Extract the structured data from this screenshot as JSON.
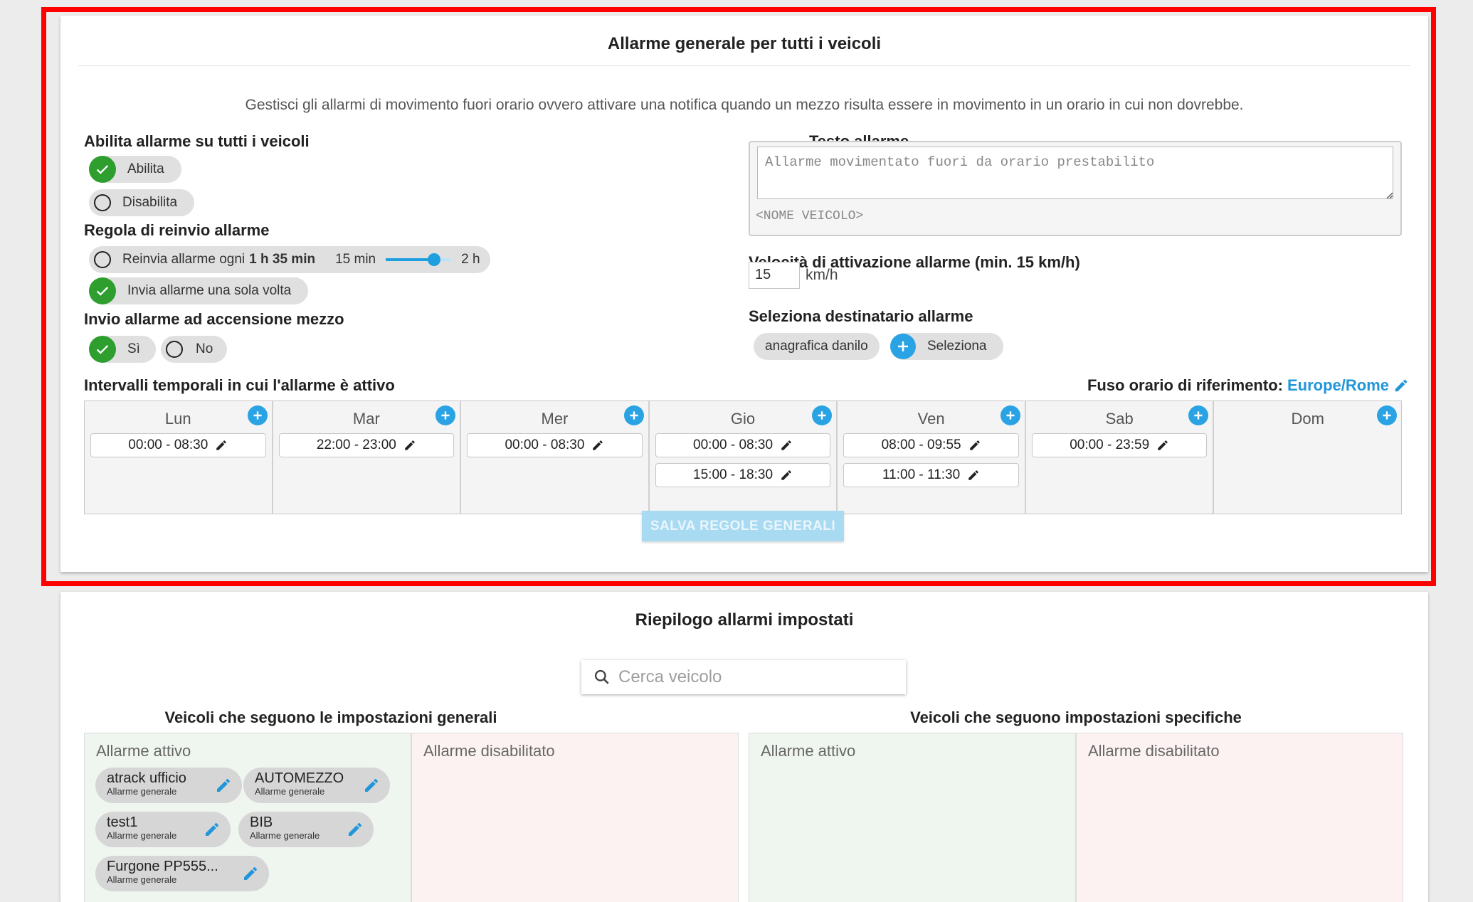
{
  "general": {
    "title": "Allarme generale per tutti i veicoli",
    "description": "Gestisci gli allarmi di movimento fuori orario ovvero attivare una notifica quando un mezzo risulta essere in movimento in un orario in cui non dovrebbe.",
    "enable_section": {
      "label": "Abilita allarme su tutti i veicoli",
      "options": [
        {
          "label": "Abilita",
          "selected": true
        },
        {
          "label": "Disabilita",
          "selected": false
        }
      ]
    },
    "resend_section": {
      "label": "Regola di reinvio allarme",
      "repeat_prefix": "Reinvia allarme ogni",
      "repeat_value": "1 h 35 min",
      "slider_min_label": "15 min",
      "slider_max_label": "2 h",
      "slider_fraction": 0.74,
      "once_label": "Invia allarme una sola volta",
      "selected": "once"
    },
    "ignition_section": {
      "label": "Invio allarme ad accensione mezzo",
      "options": [
        {
          "label": "Sì",
          "selected": true
        },
        {
          "label": "No",
          "selected": false
        }
      ]
    },
    "alarm_text": {
      "label": "Testo allarme",
      "placeholder": "Allarme movimentato fuori da orario prestabilito",
      "vehicle_tag": "<NOME VEICOLO>"
    },
    "speed": {
      "label": "Velocità di attivazione allarme (min. 15 km/h)",
      "value": "15",
      "unit": "km/h"
    },
    "recipient": {
      "label": "Seleziona destinatario allarme",
      "recipients": [
        "anagrafica danilo"
      ],
      "select_label": "Seleziona"
    },
    "intervals": {
      "label": "Intervalli temporali in cui l'allarme è attivo",
      "timezone_label": "Fuso orario di riferimento:",
      "timezone_value": "Europe/Rome",
      "days": [
        {
          "name": "Lun",
          "slots": [
            "00:00 - 08:30"
          ]
        },
        {
          "name": "Mar",
          "slots": [
            "22:00 - 23:00"
          ]
        },
        {
          "name": "Mer",
          "slots": [
            "00:00 - 08:30"
          ]
        },
        {
          "name": "Gio",
          "slots": [
            "00:00 - 08:30",
            "15:00 - 18:30"
          ]
        },
        {
          "name": "Ven",
          "slots": [
            "08:00 - 09:55",
            "11:00 - 11:30"
          ]
        },
        {
          "name": "Sab",
          "slots": [
            "00:00 - 23:59"
          ]
        },
        {
          "name": "Dom",
          "slots": []
        }
      ]
    },
    "save_label": "SALVA REGOLE GENERALI"
  },
  "summary": {
    "title": "Riepilogo allarmi impostati",
    "search_placeholder": "Cerca veicolo",
    "general_heading": "Veicoli che seguono le impostazioni generali",
    "specific_heading": "Veicoli che seguono impostazioni specifiche",
    "active_label": "Allarme attivo",
    "disabled_label": "Allarme disabilitato",
    "general_active_vehicles": [
      {
        "name": "atrack ufficio",
        "type": "Allarme generale"
      },
      {
        "name": "AUTOMEZZO",
        "type": "Allarme generale"
      },
      {
        "name": "test1",
        "type": "Allarme generale"
      },
      {
        "name": "BIB",
        "type": "Allarme generale"
      },
      {
        "name": "Furgone PP555...",
        "type": "Allarme generale"
      }
    ]
  },
  "colors": {
    "accent": "#29a3e3",
    "check": "#2e9e2e",
    "highlight": "#ff0000"
  }
}
